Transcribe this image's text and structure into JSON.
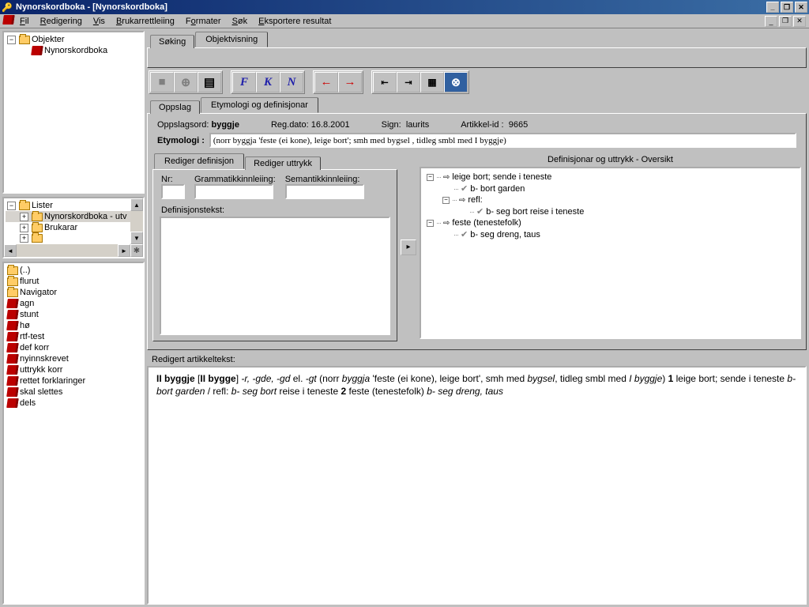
{
  "window": {
    "title": "Nynorskordboka - [Nynorskordboka]"
  },
  "menu": {
    "icon": "book-icon",
    "items": [
      "Fil",
      "Redigering",
      "Vis",
      "Brukarrettleiing",
      "Formater",
      "Søk",
      "Eksportere resultat"
    ]
  },
  "left": {
    "topTree": [
      {
        "exp": "−",
        "icon": "folder",
        "label": "Objekter",
        "indent": 0
      },
      {
        "exp": "",
        "icon": "book",
        "label": "Nynorskordboka",
        "indent": 1
      }
    ],
    "midTree": [
      {
        "exp": "−",
        "icon": "folder",
        "label": "Lister",
        "indent": 0
      },
      {
        "exp": "+",
        "icon": "folder",
        "label": "Nynorskordboka - utv",
        "indent": 1,
        "selected": true
      },
      {
        "exp": "+",
        "icon": "folder",
        "label": "Brukarar",
        "indent": 1
      },
      {
        "exp": "+",
        "icon": "folder",
        "label": "",
        "indent": 1
      }
    ],
    "botTree": [
      {
        "icon": "folder",
        "label": "(..)"
      },
      {
        "icon": "folder",
        "label": "flurut"
      },
      {
        "icon": "folder",
        "label": "Navigator"
      },
      {
        "icon": "book",
        "label": "agn"
      },
      {
        "icon": "book",
        "label": "stunt"
      },
      {
        "icon": "book",
        "label": "hø"
      },
      {
        "icon": "book",
        "label": "rtf-test"
      },
      {
        "icon": "book",
        "label": "def korr"
      },
      {
        "icon": "book",
        "label": "nyinnskrevet"
      },
      {
        "icon": "book",
        "label": "uttrykk korr"
      },
      {
        "icon": "book",
        "label": "rettet forklaringer"
      },
      {
        "icon": "book",
        "label": "skal slettes"
      },
      {
        "icon": "book",
        "label": "dels"
      }
    ]
  },
  "tabs_top": {
    "t0": "Søking",
    "t1": "Objektvisning",
    "active": 1
  },
  "toolbar": {
    "g1": [
      "stop-icon",
      "crosshair-icon",
      "page-icon"
    ],
    "g2_F": "F",
    "g2_K": "K",
    "g2_N": "N",
    "g3": [
      "arrow-left-red",
      "arrow-right-red"
    ],
    "g4": [
      "outdent-icon",
      "indent-icon",
      "table-icon",
      "lock-icon"
    ]
  },
  "tabs_mid": {
    "t0": "Oppslag",
    "t1": "Etymologi og definisjonar",
    "active": 1
  },
  "header": {
    "oppslagsord_label": "Oppslagsord:",
    "oppslagsord_value": "byggje",
    "regdato_label": "Reg.dato:",
    "regdato_value": "16.8.2001",
    "sign_label": "Sign:",
    "sign_value": "laurits",
    "artikkelid_label": "Artikkel-id :",
    "artikkelid_value": "9665",
    "etymologi_label": "Etymologi :",
    "etymologi_value": "(norr byggja 'feste (ei kone), leige bort'; smh med bygsel , tidleg smbl med I byggje)"
  },
  "tabs_def": {
    "t0": "Rediger definisjon",
    "t1": "Rediger uttrykk",
    "active": 0
  },
  "defpanel": {
    "nr_label": "Nr:",
    "gram_label": "Grammatikkinnleiing:",
    "sem_label": "Semantikkinnleiing:",
    "deftext_label": "Definisjonstekst:"
  },
  "overview": {
    "title": "Definisjonar og uttrykk - Oversikt",
    "nodes": [
      {
        "pm": "−",
        "arrow": true,
        "label": "leige bort; sende i teneste",
        "indent": 0
      },
      {
        "pm": "",
        "check": true,
        "label": "b- bort garden",
        "indent": 1
      },
      {
        "pm": "−",
        "arrow": true,
        "label": "refl:",
        "indent": 1
      },
      {
        "pm": "",
        "check": true,
        "label": "b- seg bort reise i teneste",
        "indent": 2
      },
      {
        "pm": "−",
        "arrow": true,
        "label": "feste (tenestefolk)",
        "indent": 0
      },
      {
        "pm": "",
        "check": true,
        "label": "b- seg dreng, taus",
        "indent": 1
      }
    ]
  },
  "article": {
    "label": "Redigert artikkeltekst:",
    "html_parts": {
      "p1b": "II byggje",
      "p2": " [",
      "p3b": "II bygge",
      "p4": "] ",
      "p5i": "-r, -gde, -gd",
      "p6": " el. ",
      "p7i": "-gt",
      "p8": " (norr ",
      "p9i": "byggja",
      "p10": " 'feste (ei kone), leige bort', smh med ",
      "p11i": "bygsel",
      "p12": ", tidleg smbl med ",
      "p13i": "I byggje",
      "p14": ") ",
      "p15b": "1",
      "p16": " leige bort; sende i teneste ",
      "p17i": "b- bort garden",
      "p18": " / refl: ",
      "p19i": "b- seg bort",
      "p20": " reise i teneste ",
      "p21b": "2",
      "p22": " feste (tenestefolk) ",
      "p23i": "b- seg dreng, taus"
    }
  }
}
